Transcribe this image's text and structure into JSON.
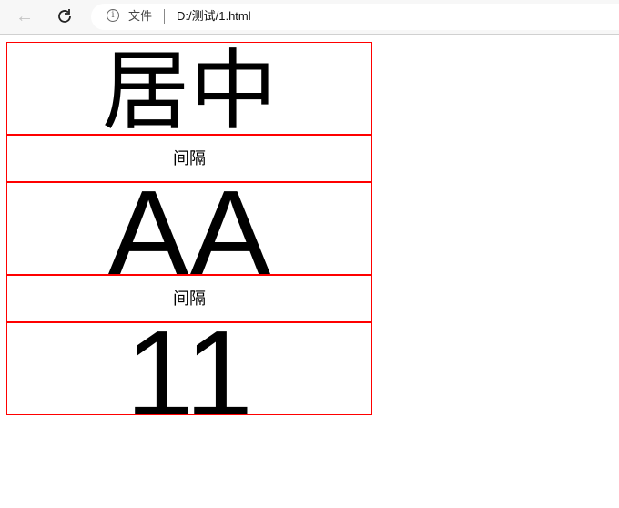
{
  "browser": {
    "back_icon": "arrow-left-icon",
    "reload_icon": "reload-icon",
    "info_icon": "info-icon",
    "file_label": "文件",
    "url": "D:/测试/1.html"
  },
  "page": {
    "boxes": [
      {
        "text": "居中"
      },
      {
        "text": "间隔"
      },
      {
        "text": "AA"
      },
      {
        "text": "间隔"
      },
      {
        "text": "11"
      }
    ]
  },
  "colors": {
    "border": "#ff0000"
  }
}
